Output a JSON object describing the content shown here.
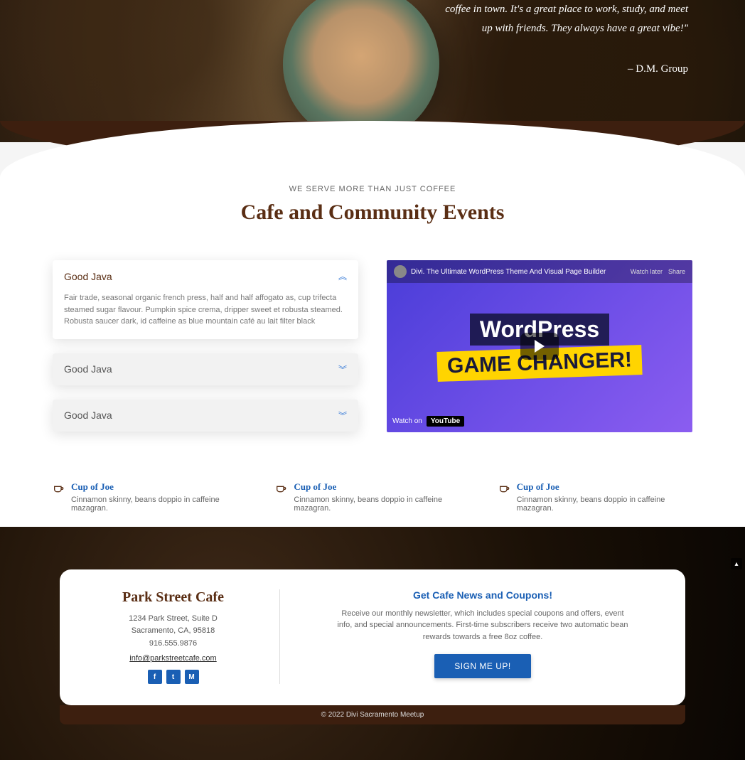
{
  "hero": {
    "testimonial": "coffee in town. It's a great place to work, study, and meet up with friends. They always have a great vibe!\"",
    "author": "– D.M. Group"
  },
  "events": {
    "subhead": "WE SERVE MORE THAN JUST COFFEE",
    "headline": "Cafe and Community Events",
    "accordion": [
      {
        "title": "Good Java",
        "body": "Fair trade, seasonal organic french press, half and half affogato as, cup trifecta steamed sugar flavour. Pumpkin spice crema, dripper sweet et robusta steamed. Robusta saucer dark, id caffeine as blue mountain café au lait filter black",
        "open": true
      },
      {
        "title": "Good Java",
        "body": "",
        "open": false
      },
      {
        "title": "Good Java",
        "body": "",
        "open": false
      }
    ],
    "video": {
      "title": "Divi. The Ultimate WordPress Theme And Visual Page Builder",
      "overlay_text": "WordPress",
      "banner": "GAME CHANGER!",
      "watch_label": "Watch on",
      "platform": "YouTube",
      "watch_later": "Watch later",
      "share": "Share"
    },
    "features": [
      {
        "title": "Cup of Joe",
        "desc": "Cinnamon skinny, beans doppio in caffeine mazagran."
      },
      {
        "title": "Cup of Joe",
        "desc": "Cinnamon skinny, beans doppio in caffeine mazagran."
      },
      {
        "title": "Cup of Joe",
        "desc": "Cinnamon skinny, beans doppio in caffeine mazagran."
      }
    ]
  },
  "footer": {
    "cafe_name": "Park Street Cafe",
    "address1": "1234 Park Street, Suite D",
    "address2": "Sacramento, CA, 95818",
    "phone": "916.555.9876",
    "email": "info@parkstreetcafe.com",
    "social": [
      "f",
      "t",
      "M"
    ],
    "news_title": "Get Cafe News and Coupons!",
    "news_desc": "Receive our monthly newsletter, which includes special coupons and offers, event info, and special announcements. First-time subscribers receive two automatic bean rewards towards a free 8oz coffee.",
    "signup": "SIGN ME UP!",
    "copyright": "© 2022 Divi Sacramento Meetup"
  }
}
